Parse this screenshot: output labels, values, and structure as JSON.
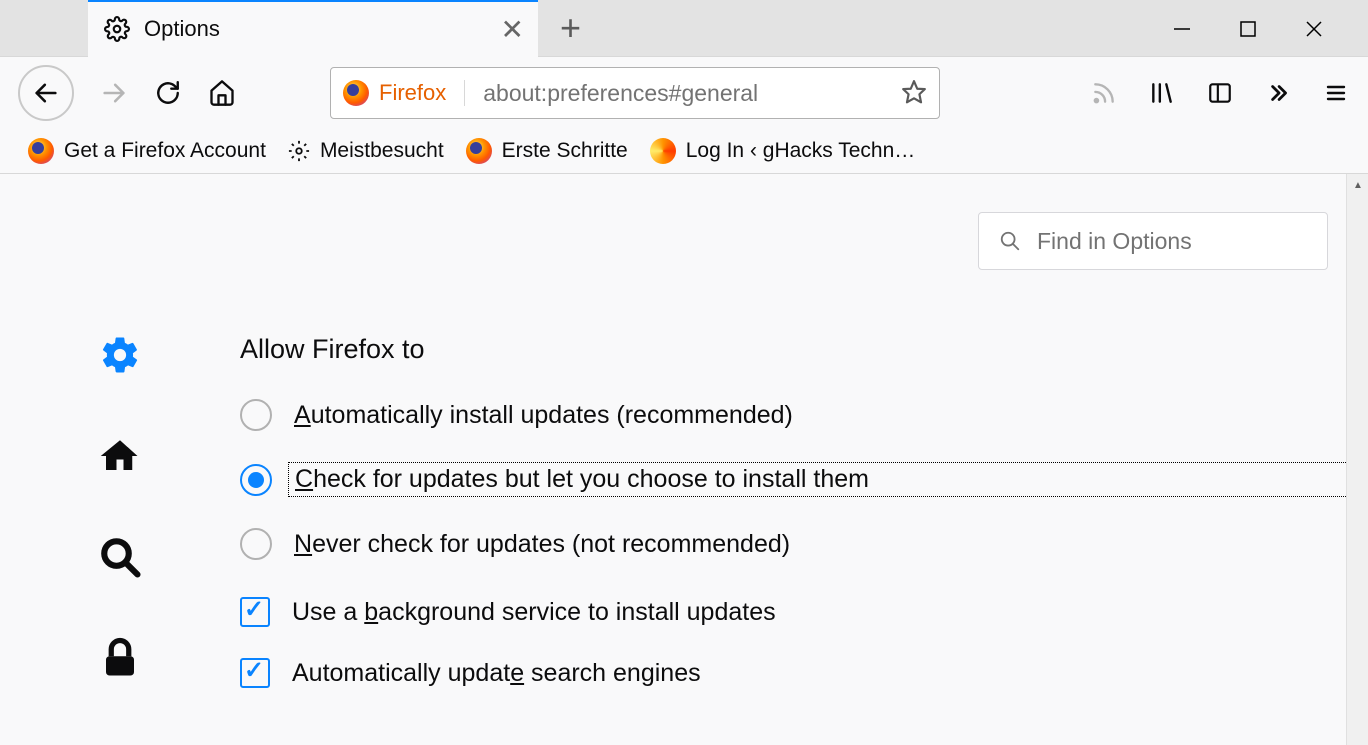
{
  "tab": {
    "title": "Options"
  },
  "url_bar": {
    "brand": "Firefox",
    "address": "about:preferences#general"
  },
  "bookmarks": [
    {
      "label": "Get a Firefox Account"
    },
    {
      "label": "Meistbesucht"
    },
    {
      "label": "Erste Schritte"
    },
    {
      "label": "Log In ‹ gHacks Techn…"
    }
  ],
  "search": {
    "placeholder": "Find in Options"
  },
  "section": {
    "title": "Allow Firefox to",
    "radios": [
      {
        "label_pre": "",
        "key": "A",
        "label_post": "utomatically install updates (recommended)",
        "selected": false
      },
      {
        "label_pre": "",
        "key": "C",
        "label_post": "heck for updates but let you choose to install them",
        "selected": true
      },
      {
        "label_pre": "",
        "key": "N",
        "label_post": "ever check for updates (not recommended)",
        "selected": false
      }
    ],
    "checks": [
      {
        "label_pre": "Use a ",
        "key": "b",
        "label_post": "ackground service to install updates",
        "checked": true
      },
      {
        "label_pre": "Automatically updat",
        "key": "e",
        "label_post": " search engines",
        "checked": true
      }
    ]
  }
}
